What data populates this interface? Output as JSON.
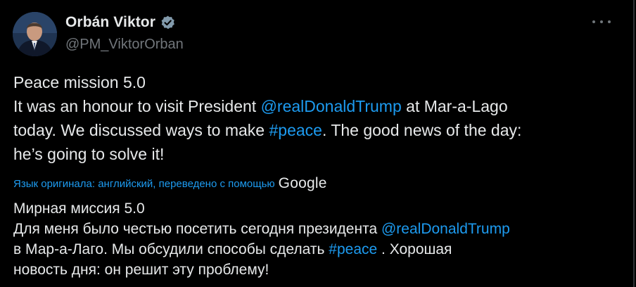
{
  "author": {
    "display_name": "Orbán Viktor",
    "handle": "@PM_ViktorOrban",
    "verified_icon": "verified-badge-icon"
  },
  "menu": {
    "icon": "more-dots-icon"
  },
  "tweet": {
    "line1": "Peace mission 5.0",
    "line2_prefix": "It was an honour to visit President ",
    "line2_mention": "@realDonaldTrump",
    "line2_suffix": " at Mar-a-Lago",
    "line3_prefix": "today. We discussed ways to make ",
    "line3_hashtag": "#peace",
    "line3_suffix": ". The good news of the day:",
    "line4": "he’s going to solve it!"
  },
  "translation": {
    "note": "Язык оригинала: английский, переведено с помощью",
    "provider": "Google",
    "line1": "Мирная миссия 5.0",
    "line2_prefix": "Для меня было честью посетить сегодня президента ",
    "line2_mention": "@realDonaldTrump",
    "line3_prefix": "в Мар-а-Лаго. Мы обсудили способы сделать ",
    "line3_hashtag": "#peace",
    "line3_suffix": " . Хорошая",
    "line4": "новость дня: он решит эту проблему!"
  },
  "colors": {
    "background": "#000000",
    "text": "#e7e9ea",
    "secondary": "#71767b",
    "accent": "#1d9bf0"
  }
}
